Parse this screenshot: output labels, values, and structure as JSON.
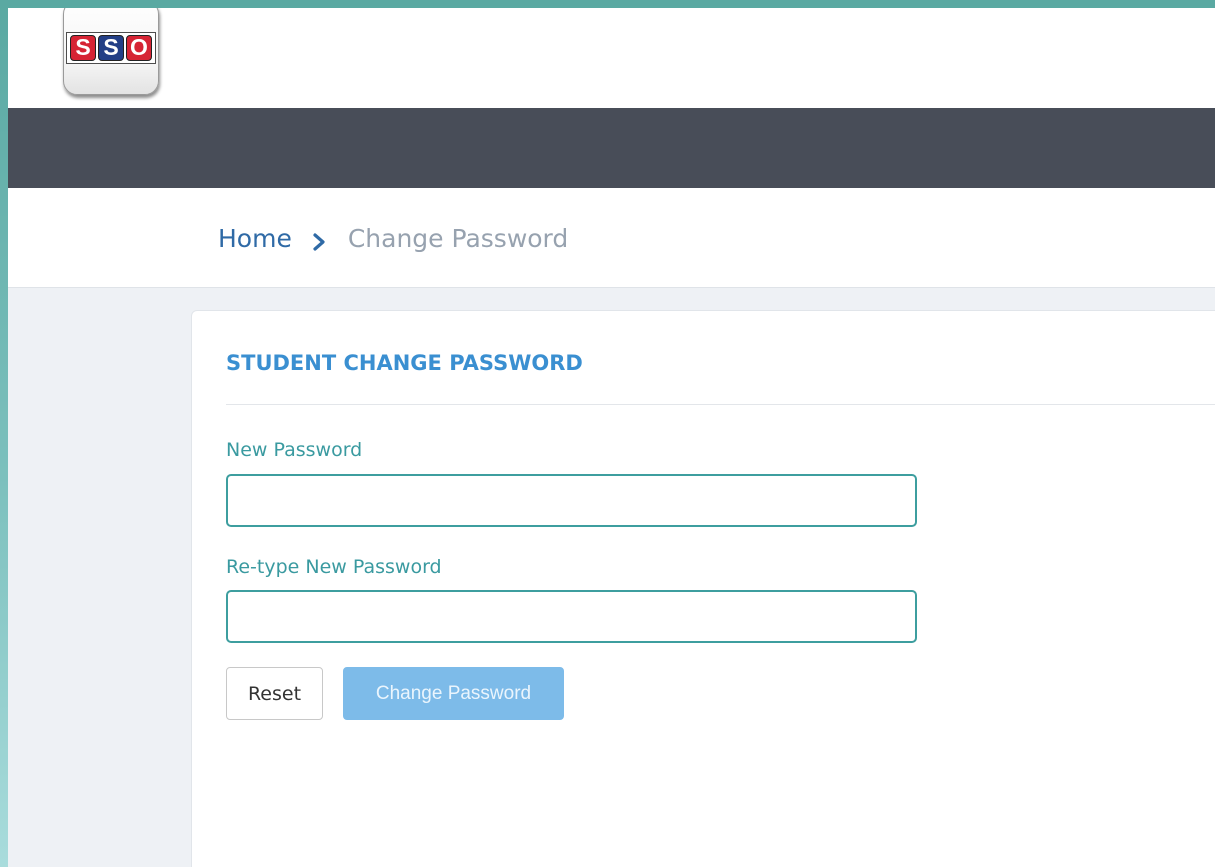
{
  "header": {
    "logo": {
      "letters": [
        "S",
        "S",
        "O"
      ],
      "letter_colors": [
        "#d62434",
        "#233f86",
        "#d62434"
      ]
    }
  },
  "breadcrumb": {
    "home": "Home",
    "current": "Change Password",
    "separator_icon": "chevron-right-icon"
  },
  "form": {
    "title": "STUDENT CHANGE PASSWORD",
    "new_password_label": "New Password",
    "new_password_value": "",
    "retype_password_label": "Re-type New Password",
    "retype_password_value": "",
    "reset_label": "Reset",
    "submit_label": "Change Password"
  },
  "colors": {
    "navbar": "#484d58",
    "title_accent": "#3a8fd1",
    "label": "#3a9aa0",
    "input_border": "#3d9e9f",
    "submit_button": "#7dbbe9",
    "breadcrumb_link": "#2f6aa6",
    "breadcrumb_current": "#97a2af"
  }
}
